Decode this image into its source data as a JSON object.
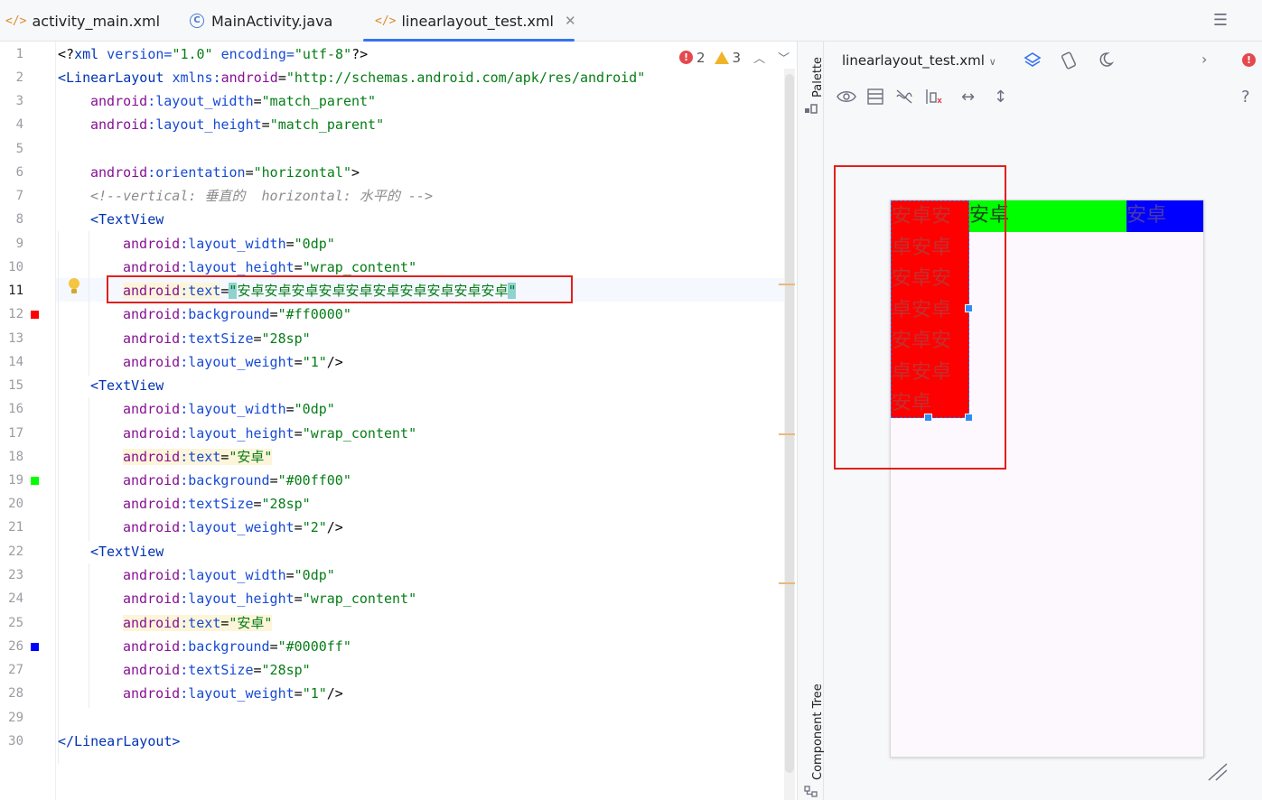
{
  "tabs": [
    {
      "label": "activity_main.xml",
      "icon": "xml-file-icon"
    },
    {
      "label": "MainActivity.java",
      "icon": "java-class-icon"
    },
    {
      "label": "linearlayout_test.xml",
      "icon": "xml-file-icon",
      "active": true
    }
  ],
  "inspections": {
    "errors": "2",
    "warnings": "3"
  },
  "editor": {
    "current_line": 11,
    "line_numbers": [
      "1",
      "2",
      "3",
      "4",
      "5",
      "6",
      "7",
      "8",
      "9",
      "10",
      "11",
      "12",
      "13",
      "14",
      "15",
      "16",
      "17",
      "18",
      "19",
      "20",
      "21",
      "22",
      "23",
      "24",
      "25",
      "26",
      "27",
      "28",
      "29",
      "30"
    ],
    "l1": {
      "a": "<?",
      "b": "xml",
      "c": " version=",
      "d": "\"1.0\"",
      "e": " encoding=",
      "f": "\"utf-8\"",
      "g": "?>"
    },
    "l2": {
      "a": "<LinearLayout ",
      "b": "xmlns:",
      "c": "android",
      "d": "=",
      "e": "\"http://schemas.android.com/apk/res/android\""
    },
    "l3": {
      "ns": "android",
      "attr": ":layout_width",
      "eq": "=",
      "val": "\"match_parent\""
    },
    "l4": {
      "ns": "android",
      "attr": ":layout_height",
      "eq": "=",
      "val": "\"match_parent\""
    },
    "l6": {
      "ns": "android",
      "attr": ":orientation",
      "eq": "=",
      "val": "\"horizontal\"",
      "end": ">"
    },
    "l7": "<!--vertical: 垂直的  horizontal: 水平的 -->",
    "l8": "<TextView",
    "l9": {
      "ns": "android",
      "attr": ":layout_width",
      "eq": "=",
      "val": "\"0dp\""
    },
    "l10": {
      "ns": "android",
      "attr": ":layout_height",
      "eq": "=",
      "val": "\"wrap_content\""
    },
    "l11": {
      "ns": "android",
      "attr": ":text",
      "eq": "=",
      "q1": "\"",
      "val": "安卓安卓安卓安卓安卓安卓安卓安卓安卓安卓",
      "q2": "\""
    },
    "l12": {
      "ns": "android",
      "attr": ":background",
      "eq": "=",
      "val": "\"#ff0000\""
    },
    "l13": {
      "ns": "android",
      "attr": ":textSize",
      "eq": "=",
      "val": "\"28sp\""
    },
    "l14": {
      "ns": "android",
      "attr": ":layout_weight",
      "eq": "=",
      "val": "\"1\"",
      "end": "/>"
    },
    "l15": "<TextView",
    "l16": {
      "ns": "android",
      "attr": ":layout_width",
      "eq": "=",
      "val": "\"0dp\""
    },
    "l17": {
      "ns": "android",
      "attr": ":layout_height",
      "eq": "=",
      "val": "\"wrap_content\""
    },
    "l18": {
      "ns": "android",
      "attr": ":text",
      "eq": "=",
      "val": "\"安卓\""
    },
    "l19": {
      "ns": "android",
      "attr": ":background",
      "eq": "=",
      "val": "\"#00ff00\""
    },
    "l20": {
      "ns": "android",
      "attr": ":textSize",
      "eq": "=",
      "val": "\"28sp\""
    },
    "l21": {
      "ns": "android",
      "attr": ":layout_weight",
      "eq": "=",
      "val": "\"2\"",
      "end": "/>"
    },
    "l22": "<TextView",
    "l23": {
      "ns": "android",
      "attr": ":layout_width",
      "eq": "=",
      "val": "\"0dp\""
    },
    "l24": {
      "ns": "android",
      "attr": ":layout_height",
      "eq": "=",
      "val": "\"wrap_content\""
    },
    "l25": {
      "ns": "android",
      "attr": ":text",
      "eq": "=",
      "val": "\"安卓\""
    },
    "l26": {
      "ns": "android",
      "attr": ":background",
      "eq": "=",
      "val": "\"#0000ff\""
    },
    "l27": {
      "ns": "android",
      "attr": ":textSize",
      "eq": "=",
      "val": "\"28sp\""
    },
    "l28": {
      "ns": "android",
      "attr": ":layout_weight",
      "eq": "=",
      "val": "\"1\"",
      "end": "/>"
    },
    "l30": "</LinearLayout>"
  },
  "side_strip": {
    "palette": "Palette",
    "component_tree": "Component Tree"
  },
  "design": {
    "file_dropdown": "linearlayout_test.xml",
    "preview": {
      "red_text": "安卓安卓安卓安卓安卓安卓安卓安卓安卓安卓",
      "green_text": "安卓",
      "blue_text": "安卓",
      "colors": {
        "red": "#ff0000",
        "green": "#00ff00",
        "blue": "#0000ff"
      }
    }
  }
}
